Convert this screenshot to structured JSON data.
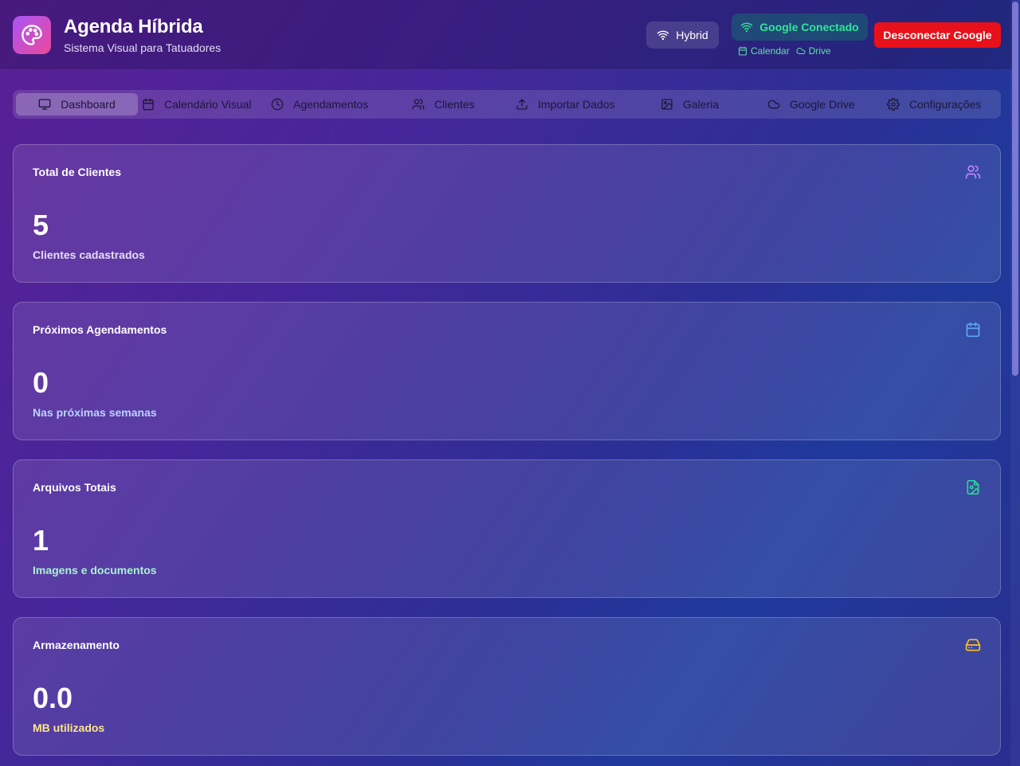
{
  "header": {
    "title": "Agenda Híbrida",
    "subtitle": "Sistema Visual para Tatuadores",
    "logo_icon": "palette-icon",
    "mode_label": "Hybrid",
    "google_status": "Google Conectado",
    "google_services": [
      "Calendar",
      "Drive"
    ],
    "disconnect_label": "Desconectar Google",
    "colors": {
      "logo_gradient": [
        "#a855f7",
        "#ec4899"
      ],
      "connected": "#34e39a",
      "disconnect": "#e8101a"
    }
  },
  "tabs": [
    {
      "label": "Dashboard",
      "icon": "monitor-icon",
      "active": true
    },
    {
      "label": "Calendário Visual",
      "icon": "calendar-icon",
      "active": false
    },
    {
      "label": "Agendamentos",
      "icon": "clock-icon",
      "active": false
    },
    {
      "label": "Clientes",
      "icon": "users-icon",
      "active": false
    },
    {
      "label": "Importar Dados",
      "icon": "upload-icon",
      "active": false
    },
    {
      "label": "Galeria",
      "icon": "image-icon",
      "active": false
    },
    {
      "label": "Google Drive",
      "icon": "cloud-icon",
      "active": false
    },
    {
      "label": "Configurações",
      "icon": "gear-icon",
      "active": false
    }
  ],
  "cards": [
    {
      "title": "Total de Clientes",
      "value": "5",
      "subtitle": "Clientes cadastrados",
      "icon": "users-icon",
      "accent": "#c084fc",
      "sub_color": "#e5ddf7"
    },
    {
      "title": "Próximos Agendamentos",
      "value": "0",
      "subtitle": "Nas próximas semanas",
      "icon": "calendar-icon",
      "accent": "#60a5fa",
      "sub_color": "#b9d3ff"
    },
    {
      "title": "Arquivos Totais",
      "value": "1",
      "subtitle": "Imagens e documentos",
      "icon": "file-image-icon",
      "accent": "#34d399",
      "sub_color": "#a7f3d0"
    },
    {
      "title": "Armazenamento",
      "value": "0.0",
      "subtitle": "MB utilizados",
      "icon": "hard-drive-icon",
      "accent": "#fbbf24",
      "sub_color": "#fde68a"
    }
  ]
}
